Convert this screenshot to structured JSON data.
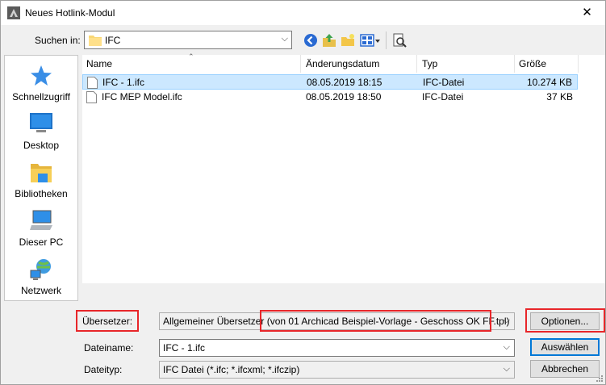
{
  "window": {
    "title": "Neues Hotlink-Modul",
    "close_glyph": "✕"
  },
  "lookin": {
    "label": "Suchen in:",
    "value": "IFC"
  },
  "toolbar": {
    "icons": [
      "back-icon",
      "up-folder-icon",
      "new-folder-icon",
      "view-menu-icon",
      "preview-icon"
    ]
  },
  "places": [
    {
      "label": "Schnellzugriff",
      "icon": "star-icon"
    },
    {
      "label": "Desktop",
      "icon": "desktop-icon"
    },
    {
      "label": "Bibliotheken",
      "icon": "libraries-icon"
    },
    {
      "label": "Dieser PC",
      "icon": "computer-icon"
    },
    {
      "label": "Netzwerk",
      "icon": "network-icon"
    }
  ],
  "columns": {
    "name": "Name",
    "date": "Änderungsdatum",
    "type": "Typ",
    "size": "Größe"
  },
  "files": [
    {
      "name": "IFC - 1.ifc",
      "date": "08.05.2019 18:15",
      "type": "IFC-Datei",
      "size": "10.274 KB",
      "selected": true
    },
    {
      "name": "IFC MEP Model.ifc",
      "date": "08.05.2019 18:50",
      "type": "IFC-Datei",
      "size": "37 KB",
      "selected": false
    }
  ],
  "translator": {
    "label": "Übersetzer:",
    "value_prefix": "Allgemeiner Übersetzer ",
    "value_highlight": "(von 01 Archicad Beispiel-Vorlage - Geschoss OK FF.tpl)",
    "options_button": "Optionen..."
  },
  "filename": {
    "label": "Dateiname:",
    "value": "IFC - 1.ifc"
  },
  "filetype": {
    "label": "Dateityp:",
    "value": "IFC Datei (*.ifc; *.ifcxml; *.ifczip)"
  },
  "buttons": {
    "select": "Auswählen",
    "cancel": "Abbrechen"
  },
  "colors": {
    "highlight_red": "#e8262a",
    "selection": "#cce8ff",
    "accent": "#0078d7"
  }
}
